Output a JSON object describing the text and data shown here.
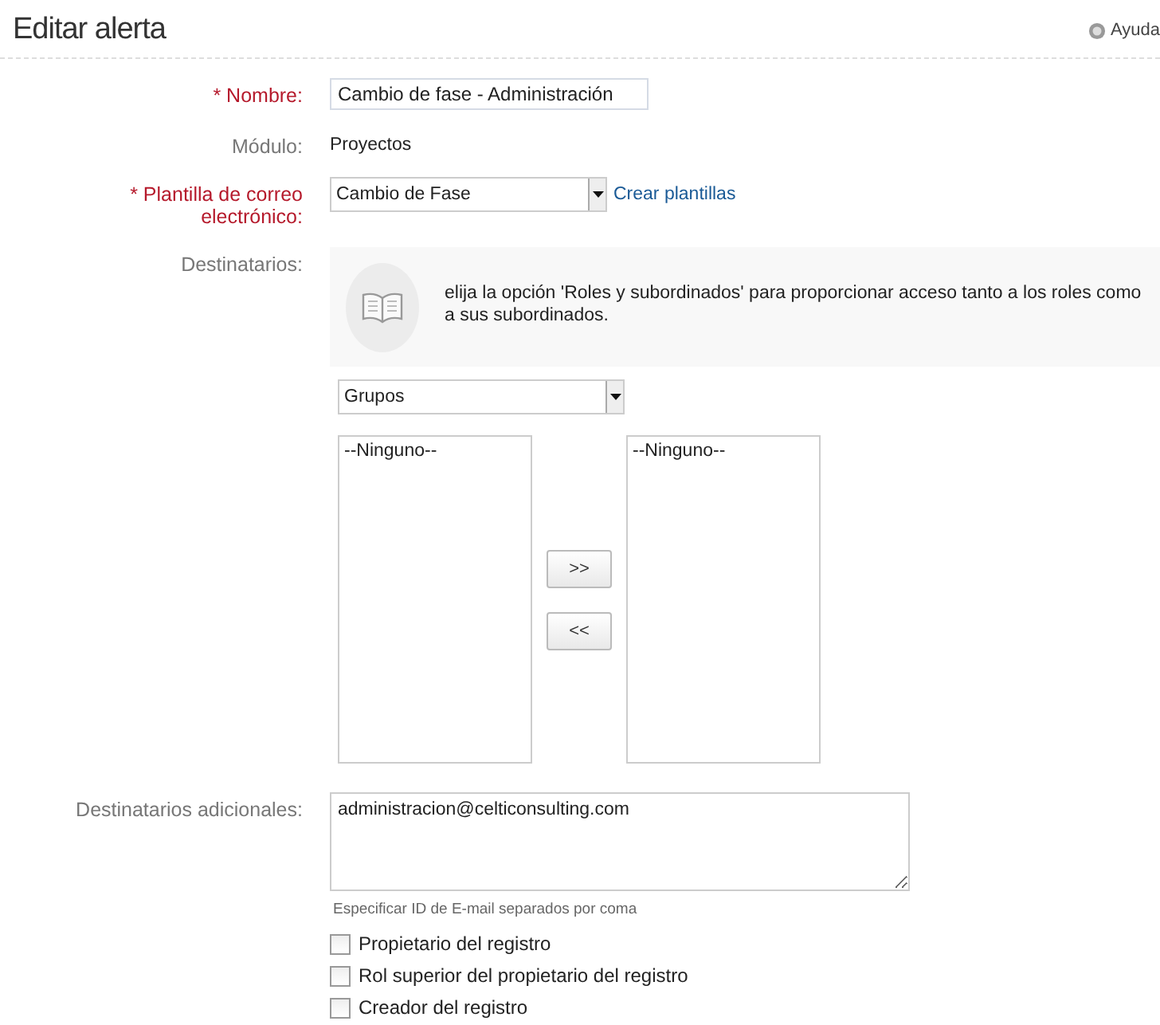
{
  "header": {
    "title": "Editar alerta",
    "help_link": "Ayuda"
  },
  "name_field": {
    "label": "* Nombre:",
    "required": true,
    "value": "Cambio de fase - Administración"
  },
  "module": {
    "label": "Módulo:",
    "value": "Proyectos"
  },
  "template": {
    "label": "* Plantilla de correo electrónico:",
    "required": true,
    "value": "Cambio de Fase",
    "link": "Crear plantillas"
  },
  "recipients": {
    "label": "Destinatarios:",
    "info": "elija la opción 'Roles y subordinados' para proporcionar acceso tanto a los roles como a sus subordinados.",
    "type_select": "Grupos",
    "available": [
      "--Ninguno--"
    ],
    "selected_list": [
      "--Ninguno--"
    ],
    "add_button": ">>",
    "remove_button": "<<"
  },
  "additional": {
    "label": "Destinatarios adicionales:",
    "value": "administracion@celticonsulting.com",
    "hint": "Especificar ID de E-mail separados por coma",
    "options": [
      {
        "label": "Propietario del registro",
        "checked": false
      },
      {
        "label": "Rol superior del propietario del registro",
        "checked": false
      },
      {
        "label": "Creador del registro",
        "checked": false
      }
    ]
  }
}
